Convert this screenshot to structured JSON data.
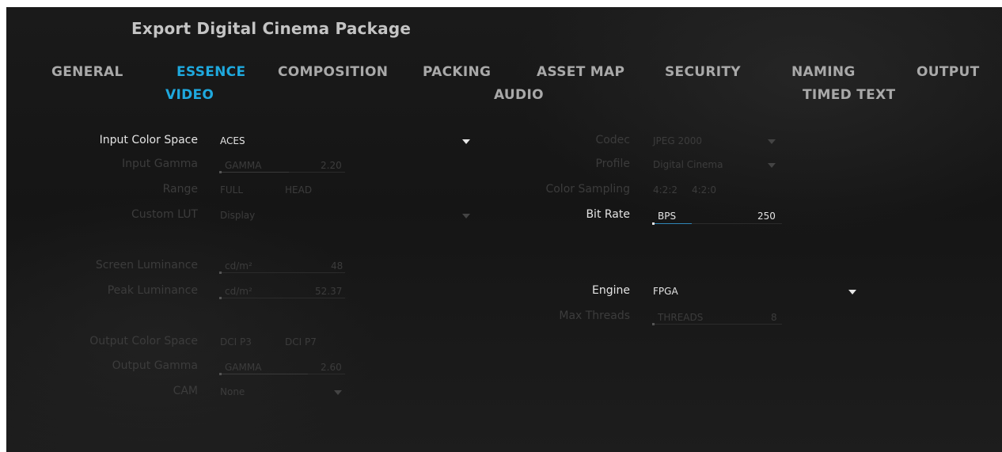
{
  "app": {
    "title": "Export Digital Cinema Package"
  },
  "tabs": [
    {
      "label": "GENERAL",
      "active": false
    },
    {
      "label": "ESSENCE",
      "active": true
    },
    {
      "label": "COMPOSITION",
      "active": false
    },
    {
      "label": "PACKING",
      "active": false
    },
    {
      "label": "ASSET MAP",
      "active": false
    },
    {
      "label": "SECURITY",
      "active": false
    },
    {
      "label": "NAMING",
      "active": false
    },
    {
      "label": "OUTPUT",
      "active": false
    }
  ],
  "subtabs": [
    {
      "label": "VIDEO",
      "active": true
    },
    {
      "label": "AUDIO",
      "active": false
    },
    {
      "label": "TIMED TEXT",
      "active": false
    }
  ],
  "left": {
    "input_color_space": {
      "label": "Input Color Space",
      "value": "ACES"
    },
    "input_gamma": {
      "label": "Input Gamma",
      "unit": "GAMMA",
      "value": "2.20",
      "fill_fraction": 0.55
    },
    "range": {
      "label": "Range",
      "options": [
        "FULL",
        "HEAD"
      ]
    },
    "custom_lut": {
      "label": "Custom LUT",
      "value": "Display"
    },
    "screen_luminance": {
      "label": "Screen Luminance",
      "unit": "cd/m²",
      "value": "48",
      "fill_fraction": 0.0
    },
    "peak_luminance": {
      "label": "Peak Luminance",
      "unit": "cd/m²",
      "value": "52.37",
      "fill_fraction": 0.0
    },
    "output_color_space": {
      "label": "Output Color Space",
      "options": [
        "DCI P3",
        "DCI P7"
      ]
    },
    "output_gamma": {
      "label": "Output Gamma",
      "unit": "GAMMA",
      "value": "2.60",
      "fill_fraction": 0.7
    },
    "cam": {
      "label": "CAM",
      "value": "None"
    }
  },
  "right": {
    "codec": {
      "label": "Codec",
      "value": "JPEG 2000"
    },
    "profile": {
      "label": "Profile",
      "value": "Digital Cinema"
    },
    "color_sampling": {
      "label": "Color Sampling",
      "options": [
        "4:2:2",
        "4:2:0"
      ]
    },
    "bit_rate": {
      "label": "Bit Rate",
      "unit": "BPS",
      "value": "250",
      "fill_fraction": 0.3
    },
    "engine": {
      "label": "Engine",
      "value": "FPGA"
    },
    "max_threads": {
      "label": "Max Threads",
      "unit": "THREADS",
      "value": "8",
      "fill_fraction": 0.0
    }
  },
  "colors": {
    "accent": "#1fa9de",
    "active_text": "#e4e4e4",
    "disabled_text": "#3c3c3c",
    "tab_text": "#a9a9a9",
    "background": "#181818"
  }
}
